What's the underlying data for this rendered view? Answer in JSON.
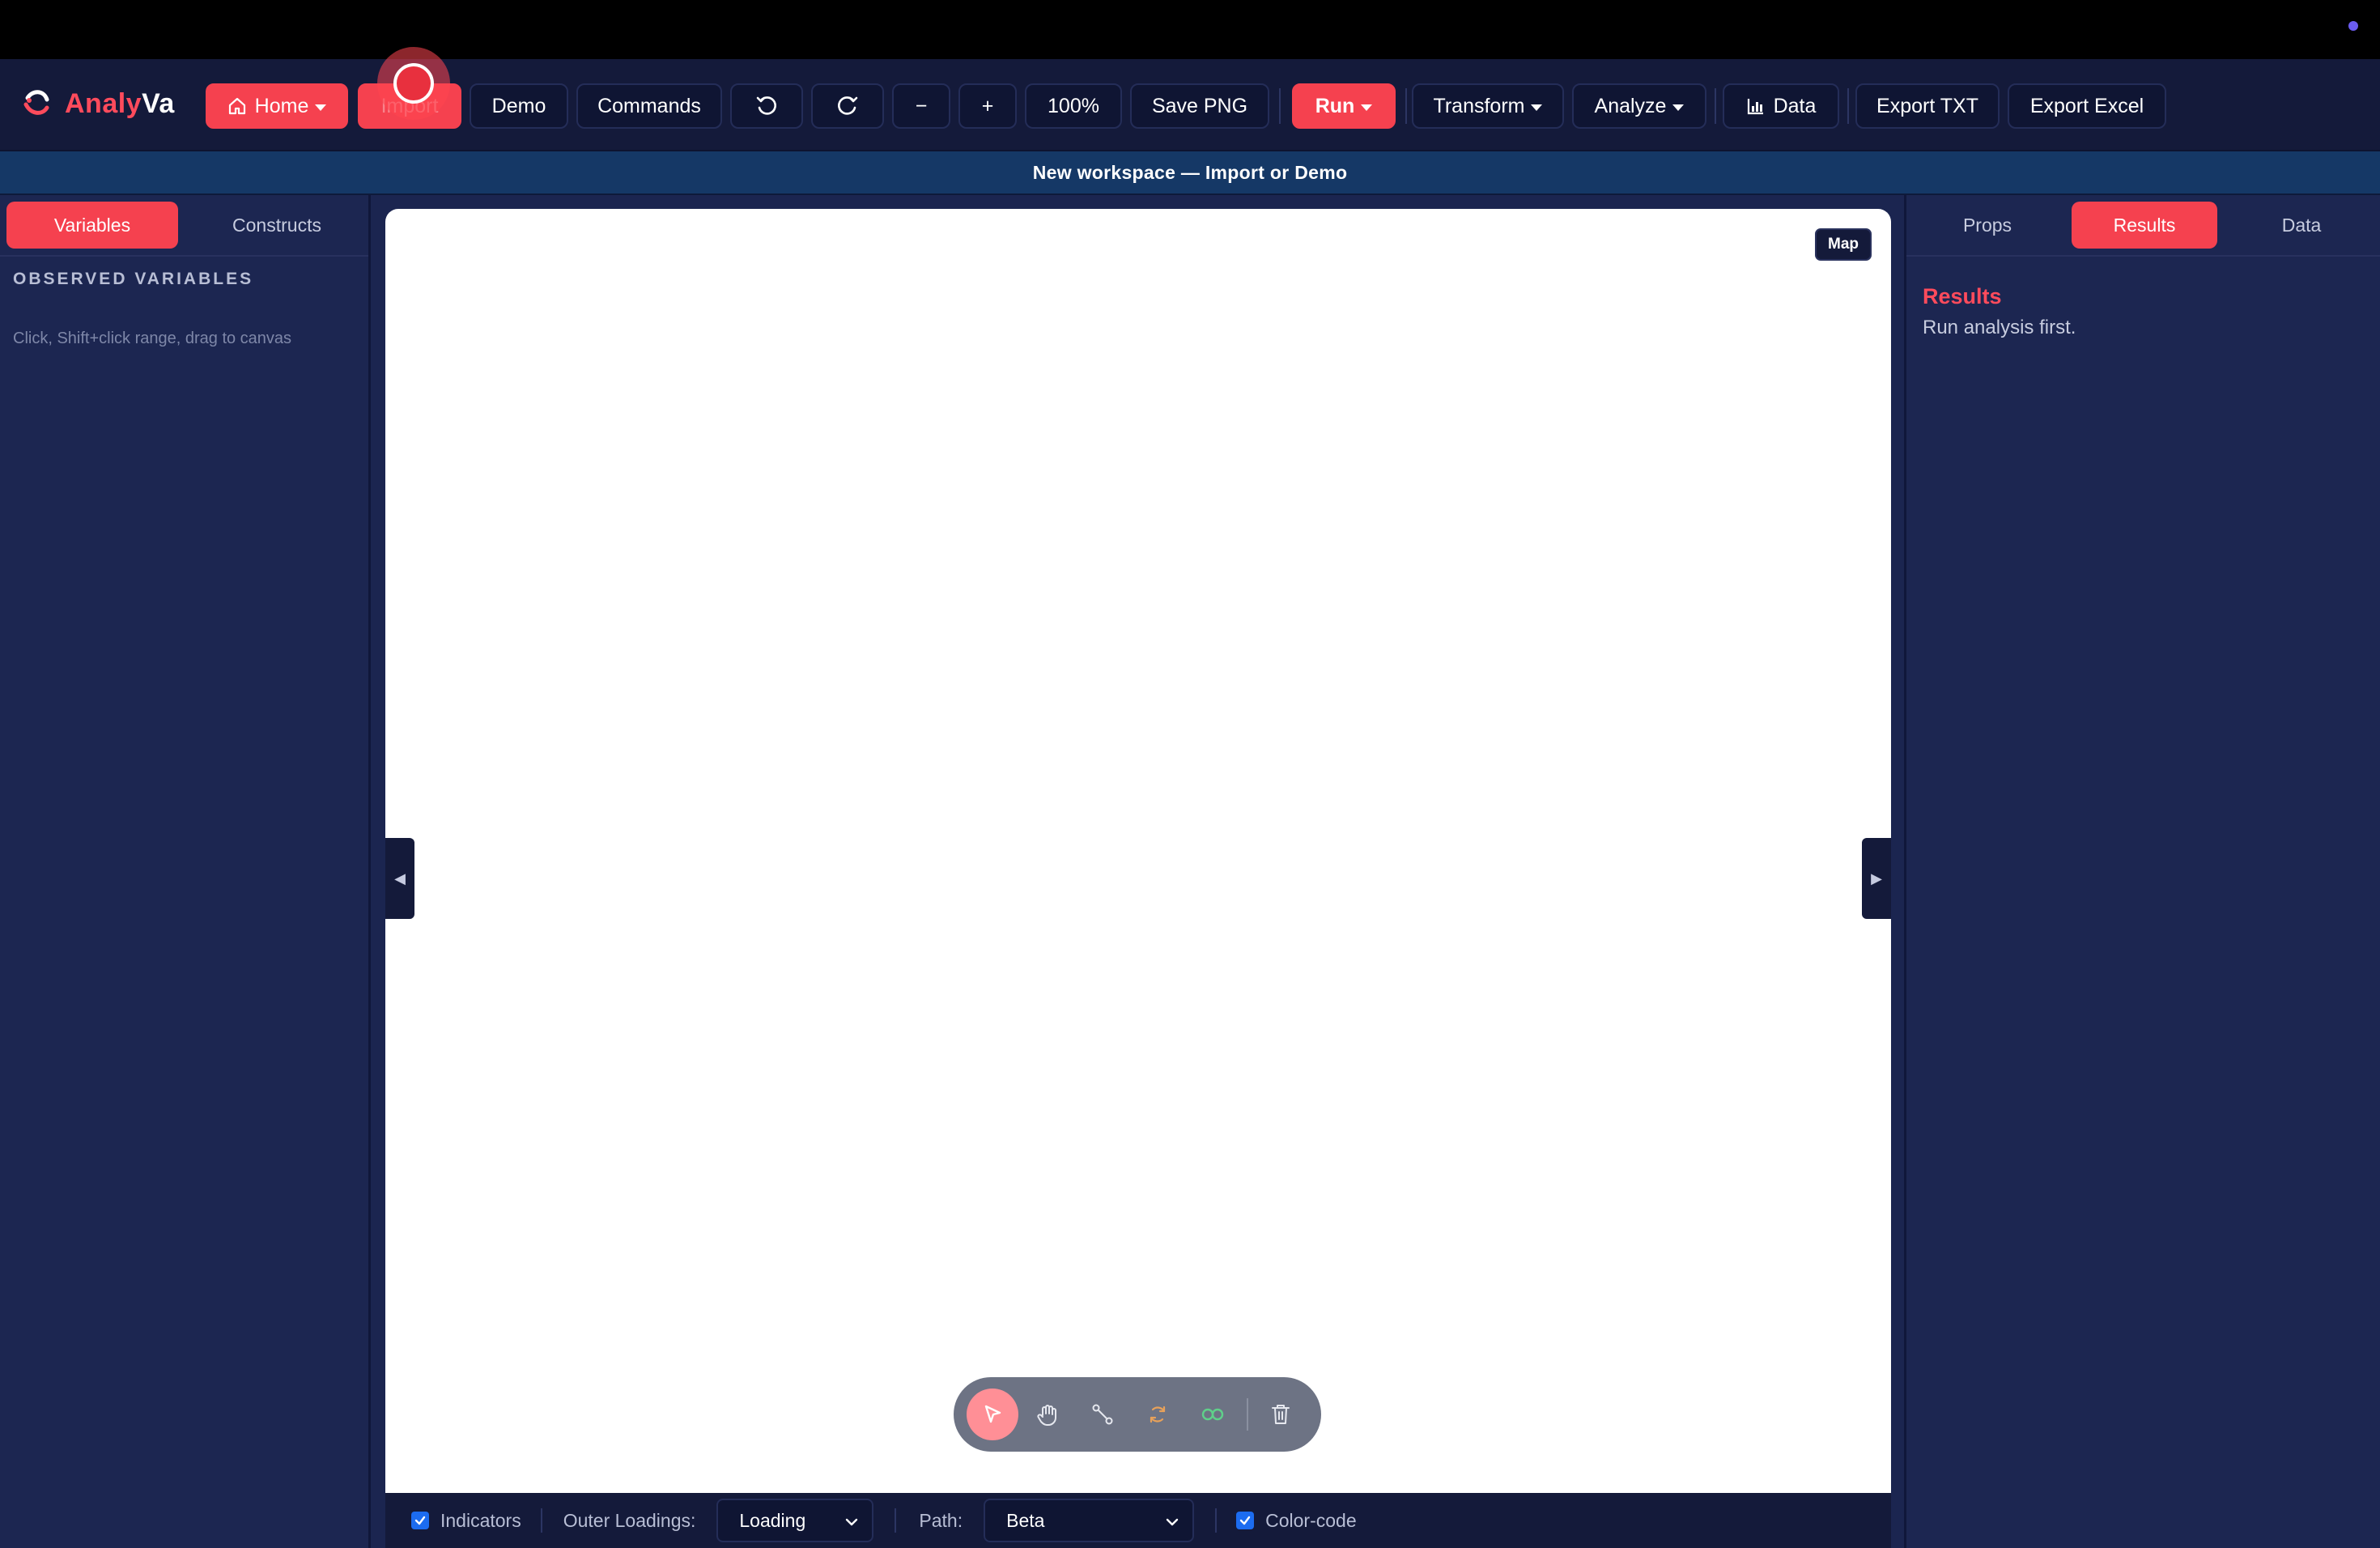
{
  "app": {
    "name_part1": "Analy",
    "name_part2": "Va"
  },
  "toolbar": {
    "home_label": "Home",
    "import_label": "Import",
    "demo_label": "Demo",
    "commands_label": "Commands",
    "zoom_out_label": "−",
    "zoom_in_label": "+",
    "zoom_level": "100%",
    "save_png_label": "Save PNG",
    "run_label": "Run",
    "transform_label": "Transform",
    "analyze_label": "Analyze",
    "data_label": "Data",
    "export_txt_label": "Export TXT",
    "export_excel_label": "Export Excel"
  },
  "banner": {
    "text": "New workspace — Import or Demo"
  },
  "left_panel": {
    "tabs": [
      {
        "label": "Variables",
        "active": true
      },
      {
        "label": "Constructs",
        "active": false
      }
    ],
    "section_title": "OBSERVED VARIABLES",
    "hint": "Click, Shift+click range, drag to canvas"
  },
  "canvas": {
    "map_label": "Map",
    "left_toggle": "◀",
    "right_toggle": "▶",
    "tools": [
      "select-tool",
      "pan-tool",
      "connect-tool",
      "construct-tool",
      "link-tool",
      "delete-tool"
    ]
  },
  "bottom_bar": {
    "indicators_label": "Indicators",
    "indicators_checked": true,
    "outer_loadings_label": "Outer Loadings:",
    "outer_loadings_value": "Loading",
    "path_label": "Path:",
    "path_value": "Beta",
    "color_code_label": "Color-code",
    "color_code_checked": true
  },
  "right_panel": {
    "tabs": [
      {
        "label": "Props",
        "active": false
      },
      {
        "label": "Results",
        "active": true
      },
      {
        "label": "Data",
        "active": false
      }
    ],
    "results_title": "Results",
    "results_message": "Run analysis first."
  },
  "colors": {
    "accent": "#f5414f",
    "toolbar_bg": "#141a3a",
    "panel_bg": "#1c2651",
    "banner_bg": "#153866",
    "checkbox": "#1c6cf0"
  }
}
